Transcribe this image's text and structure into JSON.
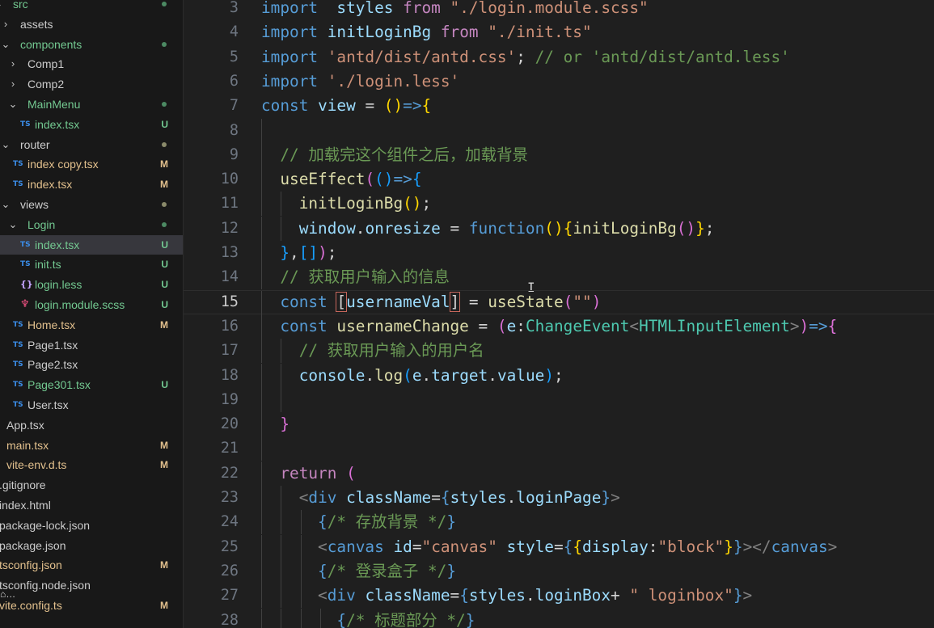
{
  "explorer": {
    "items": [
      {
        "label": "src",
        "depth": 0,
        "kind": "folder",
        "open": true,
        "status": "dot",
        "tone": "git"
      },
      {
        "label": "assets",
        "depth": 1,
        "kind": "folder",
        "open": false,
        "status": "",
        "tone": ""
      },
      {
        "label": "components",
        "depth": 1,
        "kind": "folder",
        "open": true,
        "status": "dot",
        "tone": "git"
      },
      {
        "label": "Comp1",
        "depth": 2,
        "kind": "folder",
        "open": false,
        "status": "",
        "tone": ""
      },
      {
        "label": "Comp2",
        "depth": 2,
        "kind": "folder",
        "open": false,
        "status": "",
        "tone": ""
      },
      {
        "label": "MainMenu",
        "depth": 2,
        "kind": "folder",
        "open": true,
        "status": "dot",
        "tone": "git"
      },
      {
        "label": "index.tsx",
        "depth": 3,
        "kind": "ts",
        "status": "U",
        "tone": "git"
      },
      {
        "label": "router",
        "depth": 1,
        "kind": "folder",
        "open": true,
        "status": "dot",
        "tone": "plain"
      },
      {
        "label": "index copy.tsx",
        "depth": 2,
        "kind": "ts",
        "status": "M",
        "tone": "mod"
      },
      {
        "label": "index.tsx",
        "depth": 2,
        "kind": "ts",
        "status": "M",
        "tone": "mod"
      },
      {
        "label": "views",
        "depth": 1,
        "kind": "folder",
        "open": true,
        "status": "dot",
        "tone": "plain"
      },
      {
        "label": "Login",
        "depth": 2,
        "kind": "folder",
        "open": true,
        "status": "dot",
        "tone": "git"
      },
      {
        "label": "index.tsx",
        "depth": 3,
        "kind": "ts",
        "status": "U",
        "tone": "git",
        "selected": true
      },
      {
        "label": "init.ts",
        "depth": 3,
        "kind": "ts",
        "status": "U",
        "tone": "git"
      },
      {
        "label": "login.less",
        "depth": 3,
        "kind": "less",
        "status": "U",
        "tone": "git"
      },
      {
        "label": "login.module.scss",
        "depth": 3,
        "kind": "scss",
        "status": "U",
        "tone": "git"
      },
      {
        "label": "Home.tsx",
        "depth": 2,
        "kind": "ts",
        "status": "M",
        "tone": "mod"
      },
      {
        "label": "Page1.tsx",
        "depth": 2,
        "kind": "ts",
        "status": "",
        "tone": ""
      },
      {
        "label": "Page2.tsx",
        "depth": 2,
        "kind": "ts",
        "status": "",
        "tone": ""
      },
      {
        "label": "Page301.tsx",
        "depth": 2,
        "kind": "ts",
        "status": "U",
        "tone": "git"
      },
      {
        "label": "User.tsx",
        "depth": 2,
        "kind": "ts",
        "status": "",
        "tone": ""
      },
      {
        "label": "App.tsx",
        "depth": 1,
        "kind": "file",
        "status": "",
        "tone": ""
      },
      {
        "label": "main.tsx",
        "depth": 1,
        "kind": "file",
        "status": "M",
        "tone": "mod"
      },
      {
        "label": "vite-env.d.ts",
        "depth": 1,
        "kind": "file",
        "status": "M",
        "tone": "mod"
      },
      {
        "label": ".gitignore",
        "depth": 0,
        "kind": "file",
        "status": "",
        "tone": ""
      },
      {
        "label": "index.html",
        "depth": 0,
        "kind": "file",
        "status": "",
        "tone": ""
      },
      {
        "label": "package-lock.json",
        "depth": 0,
        "kind": "file",
        "status": "",
        "tone": ""
      },
      {
        "label": "package.json",
        "depth": 0,
        "kind": "file",
        "status": "",
        "tone": ""
      },
      {
        "label": "tsconfig.json",
        "depth": 0,
        "kind": "file",
        "status": "M",
        "tone": "mod"
      },
      {
        "label": "tsconfig.node.json",
        "depth": 0,
        "kind": "file",
        "status": "",
        "tone": ""
      },
      {
        "label": "vite.config.ts",
        "depth": 0,
        "kind": "file",
        "status": "M",
        "tone": "mod"
      }
    ],
    "overlay_glyph": "⌂…"
  },
  "icons": {
    "ts": "TS",
    "less": "{}",
    "scss": "♆"
  },
  "editor": {
    "current_line": 15,
    "lines": [
      {
        "n": 3,
        "indent": 0,
        "tokens": [
          [
            "kw",
            "import"
          ],
          [
            "",
            "  "
          ],
          [
            "var",
            "styles"
          ],
          [
            "",
            " "
          ],
          [
            "kc",
            "from"
          ],
          [
            "",
            " "
          ],
          [
            "str",
            "\"./login.module.scss\""
          ]
        ]
      },
      {
        "n": 4,
        "indent": 0,
        "tokens": [
          [
            "kw",
            "import"
          ],
          [
            "",
            " "
          ],
          [
            "var",
            "initLoginBg"
          ],
          [
            "",
            " "
          ],
          [
            "kc",
            "from"
          ],
          [
            "",
            " "
          ],
          [
            "str",
            "\"./init.ts\""
          ]
        ]
      },
      {
        "n": 5,
        "indent": 0,
        "tokens": [
          [
            "kw",
            "import"
          ],
          [
            "",
            " "
          ],
          [
            "str",
            "'antd/dist/antd.css'"
          ],
          [
            "",
            ";"
          ],
          [
            "",
            " "
          ],
          [
            "cmt",
            "// or 'antd/dist/antd.less'"
          ]
        ]
      },
      {
        "n": 6,
        "indent": 0,
        "tokens": [
          [
            "kw",
            "import"
          ],
          [
            "",
            " "
          ],
          [
            "str",
            "'./login.less'"
          ]
        ]
      },
      {
        "n": 7,
        "indent": 0,
        "tokens": [
          [
            "kw",
            "const"
          ],
          [
            "",
            " "
          ],
          [
            "var",
            "view"
          ],
          [
            "",
            " = "
          ],
          [
            "b1",
            "()"
          ],
          [
            "kw",
            "=>"
          ],
          [
            "b1",
            "{"
          ]
        ]
      },
      {
        "n": 8,
        "indent": 1,
        "tokens": []
      },
      {
        "n": 9,
        "indent": 1,
        "tokens": [
          [
            "",
            "  "
          ],
          [
            "cmt",
            "// 加载完这个组件之后，加载背景"
          ]
        ]
      },
      {
        "n": 10,
        "indent": 1,
        "tokens": [
          [
            "",
            "  "
          ],
          [
            "fn",
            "useEffect"
          ],
          [
            "b2",
            "("
          ],
          [
            "b3",
            "()"
          ],
          [
            "kw",
            "=>"
          ],
          [
            "b3",
            "{"
          ]
        ]
      },
      {
        "n": 11,
        "indent": 2,
        "tokens": [
          [
            "",
            "    "
          ],
          [
            "fn",
            "initLoginBg"
          ],
          [
            "b1",
            "()"
          ],
          [
            "",
            ";"
          ]
        ]
      },
      {
        "n": 12,
        "indent": 2,
        "tokens": [
          [
            "",
            "    "
          ],
          [
            "var",
            "window"
          ],
          [
            "",
            "."
          ],
          [
            "var",
            "onresize"
          ],
          [
            "",
            " = "
          ],
          [
            "kw",
            "function"
          ],
          [
            "b1",
            "()"
          ],
          [
            "b1",
            "{"
          ],
          [
            "fn",
            "initLoginBg"
          ],
          [
            "b2",
            "()"
          ],
          [
            "b1",
            "}"
          ],
          [
            "",
            ";"
          ]
        ]
      },
      {
        "n": 13,
        "indent": 1,
        "tokens": [
          [
            "",
            "  "
          ],
          [
            "b3",
            "}"
          ],
          [
            "",
            ","
          ],
          [
            "b3",
            "[]"
          ],
          [
            "b2",
            ")"
          ],
          [
            "",
            ";"
          ]
        ]
      },
      {
        "n": 14,
        "indent": 1,
        "tokens": [
          [
            "",
            "  "
          ],
          [
            "cmt",
            "// 获取用户输入的信息"
          ]
        ]
      },
      {
        "n": 15,
        "indent": 1,
        "tokens": [
          [
            "",
            "  "
          ],
          [
            "kw",
            "const"
          ],
          [
            "",
            " "
          ],
          [
            "hl",
            "["
          ],
          [
            "var",
            "usernameVal"
          ],
          [
            "hl",
            "]"
          ],
          [
            "",
            " = "
          ],
          [
            "fn",
            "useState"
          ],
          [
            "b2",
            "("
          ],
          [
            "str",
            "\"\""
          ],
          [
            "b2",
            ")"
          ]
        ]
      },
      {
        "n": 16,
        "indent": 1,
        "tokens": [
          [
            "",
            "  "
          ],
          [
            "kw",
            "const"
          ],
          [
            "",
            " "
          ],
          [
            "fn",
            "usernameChange"
          ],
          [
            "",
            " = "
          ],
          [
            "b2",
            "("
          ],
          [
            "var",
            "e"
          ],
          [
            "",
            ":"
          ],
          [
            "typ",
            "ChangeEvent"
          ],
          [
            "tagb",
            "<"
          ],
          [
            "typ",
            "HTMLInputElement"
          ],
          [
            "tagb",
            ">"
          ],
          [
            "b2",
            ")"
          ],
          [
            "kw",
            "=>"
          ],
          [
            "b2",
            "{"
          ]
        ]
      },
      {
        "n": 17,
        "indent": 2,
        "tokens": [
          [
            "",
            "    "
          ],
          [
            "cmt",
            "// 获取用户输入的用户名"
          ]
        ]
      },
      {
        "n": 18,
        "indent": 2,
        "tokens": [
          [
            "",
            "    "
          ],
          [
            "var",
            "console"
          ],
          [
            "",
            "."
          ],
          [
            "fn",
            "log"
          ],
          [
            "b3",
            "("
          ],
          [
            "var",
            "e"
          ],
          [
            "",
            "."
          ],
          [
            "var",
            "target"
          ],
          [
            "",
            "."
          ],
          [
            "var",
            "value"
          ],
          [
            "b3",
            ")"
          ],
          [
            "",
            ";"
          ]
        ]
      },
      {
        "n": 19,
        "indent": 2,
        "tokens": []
      },
      {
        "n": 20,
        "indent": 1,
        "tokens": [
          [
            "",
            "  "
          ],
          [
            "b2",
            "}"
          ]
        ]
      },
      {
        "n": 21,
        "indent": 1,
        "tokens": []
      },
      {
        "n": 22,
        "indent": 1,
        "tokens": [
          [
            "",
            "  "
          ],
          [
            "kc",
            "return"
          ],
          [
            "",
            " "
          ],
          [
            "b2",
            "("
          ]
        ]
      },
      {
        "n": 23,
        "indent": 2,
        "tokens": [
          [
            "",
            "    "
          ],
          [
            "tagb",
            "<"
          ],
          [
            "tag",
            "div"
          ],
          [
            "",
            " "
          ],
          [
            "var",
            "className"
          ],
          [
            "",
            "="
          ],
          [
            "kw",
            "{"
          ],
          [
            "var",
            "styles"
          ],
          [
            "",
            "."
          ],
          [
            "var",
            "loginPage"
          ],
          [
            "kw",
            "}"
          ],
          [
            "tagb",
            ">"
          ]
        ]
      },
      {
        "n": 24,
        "indent": 3,
        "tokens": [
          [
            "",
            "      "
          ],
          [
            "kw",
            "{"
          ],
          [
            "cmt",
            "/* 存放背景 */"
          ],
          [
            "kw",
            "}"
          ]
        ]
      },
      {
        "n": 25,
        "indent": 3,
        "tokens": [
          [
            "",
            "      "
          ],
          [
            "tagb",
            "<"
          ],
          [
            "tag",
            "canvas"
          ],
          [
            "",
            " "
          ],
          [
            "var",
            "id"
          ],
          [
            "",
            "="
          ],
          [
            "str",
            "\"canvas\""
          ],
          [
            "",
            " "
          ],
          [
            "var",
            "style"
          ],
          [
            "",
            "="
          ],
          [
            "kw",
            "{"
          ],
          [
            "b1",
            "{"
          ],
          [
            "var",
            "display"
          ],
          [
            "",
            ":"
          ],
          [
            "str",
            "\"block\""
          ],
          [
            "b1",
            "}"
          ],
          [
            "kw",
            "}"
          ],
          [
            "tagb",
            "></"
          ],
          [
            "tag",
            "canvas"
          ],
          [
            "tagb",
            ">"
          ]
        ]
      },
      {
        "n": 26,
        "indent": 3,
        "tokens": [
          [
            "",
            "      "
          ],
          [
            "kw",
            "{"
          ],
          [
            "cmt",
            "/* 登录盒子 */"
          ],
          [
            "kw",
            "}"
          ]
        ]
      },
      {
        "n": 27,
        "indent": 3,
        "tokens": [
          [
            "",
            "      "
          ],
          [
            "tagb",
            "<"
          ],
          [
            "tag",
            "div"
          ],
          [
            "",
            " "
          ],
          [
            "var",
            "className"
          ],
          [
            "",
            "="
          ],
          [
            "kw",
            "{"
          ],
          [
            "var",
            "styles"
          ],
          [
            "",
            "."
          ],
          [
            "var",
            "loginBox"
          ],
          [
            "",
            "+ "
          ],
          [
            "str",
            "\" loginbox\""
          ],
          [
            "kw",
            "}"
          ],
          [
            "tagb",
            ">"
          ]
        ]
      },
      {
        "n": 28,
        "indent": 4,
        "tokens": [
          [
            "",
            "        "
          ],
          [
            "kw",
            "{"
          ],
          [
            "cmt",
            "/* 标题部分 */"
          ],
          [
            "kw",
            "}"
          ]
        ]
      }
    ]
  }
}
